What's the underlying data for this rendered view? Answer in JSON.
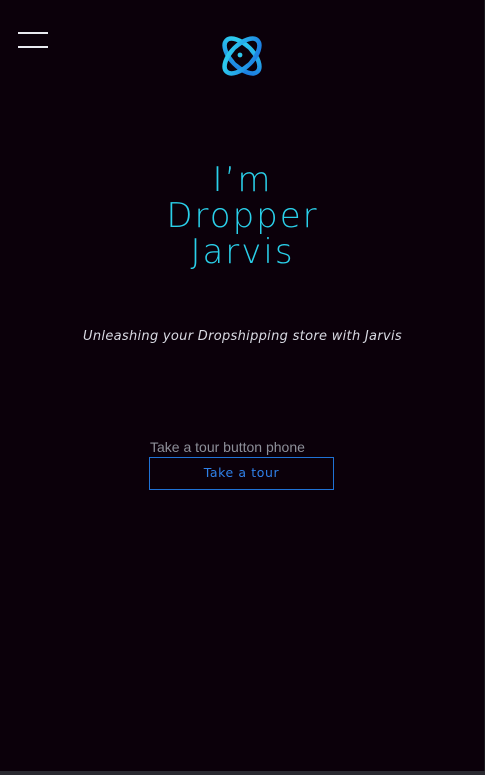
{
  "header": {
    "menu_icon": "hamburger-menu-icon",
    "logo_icon": "atom-orbit-logo-icon"
  },
  "hero": {
    "title_lines": [
      "I’m",
      "Dropper",
      "Jarvis"
    ],
    "tagline": "Unleashing your Dropshipping store with Jarvis"
  },
  "tour": {
    "caption": "Take a tour button phone",
    "button_label": "Take a tour"
  },
  "colors": {
    "background": "#0b000a",
    "title": "#2ad0ea",
    "button_border": "#1f72d6",
    "logo_gradient_start": "#2fd6f0",
    "logo_gradient_end": "#1a74e0"
  }
}
